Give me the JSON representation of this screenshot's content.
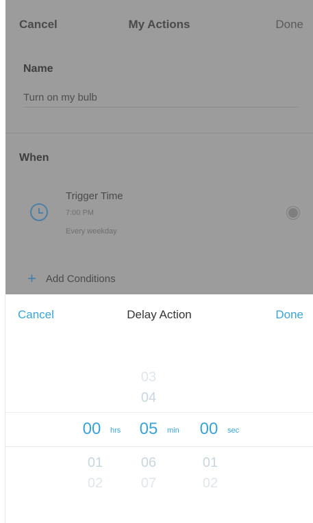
{
  "background": {
    "nav": {
      "cancel": "Cancel",
      "title": "My Actions",
      "done": "Done"
    },
    "name": {
      "label": "Name",
      "value": "Turn on my bulb"
    },
    "when": {
      "label": "When"
    },
    "trigger": {
      "title": "Trigger Time",
      "time": "7:00 PM",
      "repeat": "Every weekday",
      "icon": "clock-icon"
    },
    "add_conditions": {
      "label": "Add Conditions"
    }
  },
  "sheet": {
    "cancel": "Cancel",
    "title": "Delay Action",
    "done": "Done",
    "picker": {
      "hours": {
        "above2": "",
        "above1": "",
        "selected": "00",
        "below1": "01",
        "below2": "02",
        "unit": "hrs"
      },
      "minutes": {
        "above2": "03",
        "above1": "04",
        "selected": "05",
        "below1": "06",
        "below2": "07",
        "unit": "min"
      },
      "seconds": {
        "above2": "",
        "above1": "",
        "selected": "00",
        "below1": "01",
        "below2": "02",
        "unit": "sec"
      }
    }
  },
  "colors": {
    "accent": "#3aa3d6",
    "overlay": "#9c9c9c"
  }
}
